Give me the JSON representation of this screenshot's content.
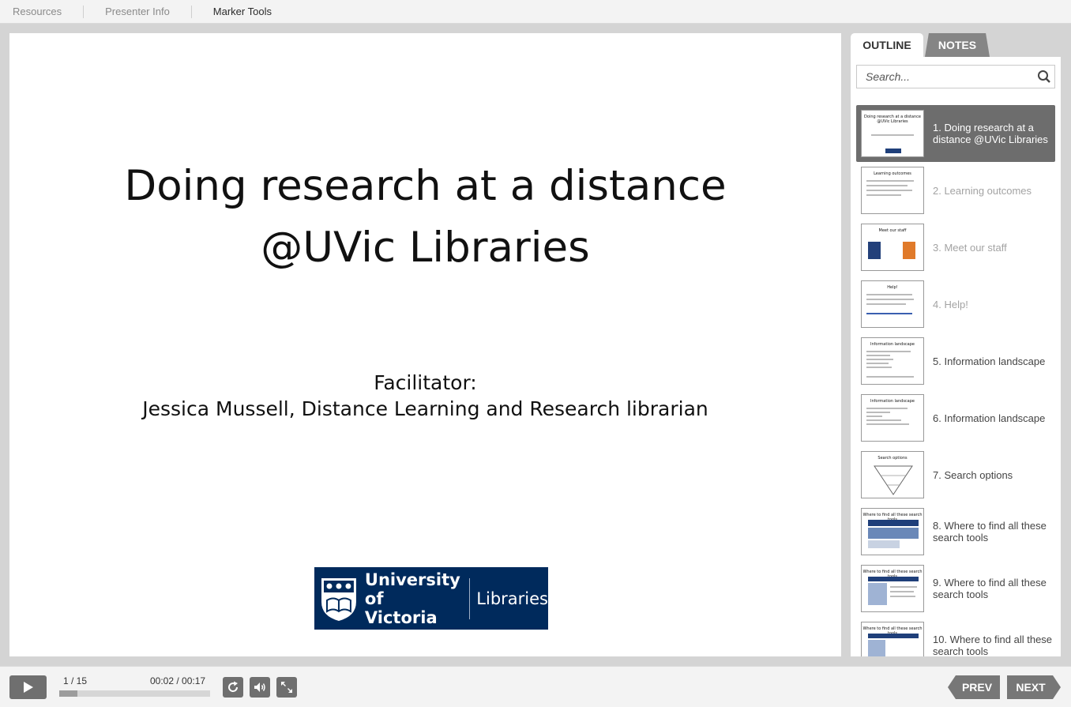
{
  "top_menu": {
    "resources": "Resources",
    "presenter_info": "Presenter Info",
    "marker_tools": "Marker Tools"
  },
  "slide": {
    "title_line1": "Doing research at a distance",
    "title_line2": "@UVic Libraries",
    "sub_line1": "Facilitator:",
    "sub_line2": "Jessica Mussell, Distance Learning and Research librarian",
    "logo_line1": "University",
    "logo_line2": "of Victoria",
    "logo_libraries": "Libraries",
    "logo_color": "#002a5c"
  },
  "sidebar": {
    "tab_outline": "OUTLINE",
    "tab_notes": "NOTES",
    "search_placeholder": "Search...",
    "items": [
      {
        "label": "1. Doing research at a distance @UVic Libraries",
        "thumb_title": "Doing research at a distance @UVic Libraries"
      },
      {
        "label": "2. Learning outcomes",
        "thumb_title": "Learning outcomes"
      },
      {
        "label": "3. Meet our staff",
        "thumb_title": "Meet our staff"
      },
      {
        "label": "4. Help!",
        "thumb_title": "Help!"
      },
      {
        "label": "5. Information landscape",
        "thumb_title": "Information landscape"
      },
      {
        "label": "6. Information landscape",
        "thumb_title": "Information landscape"
      },
      {
        "label": "7. Search options",
        "thumb_title": "Search options"
      },
      {
        "label": "8. Where to find all these search tools",
        "thumb_title": "Where to find all these search tools"
      },
      {
        "label": "9. Where to find all these search tools",
        "thumb_title": "Where to find all these search tools"
      },
      {
        "label": "10. Where to find all these search tools",
        "thumb_title": "Where to find all these search tools"
      }
    ]
  },
  "player": {
    "slide_count": "1 / 15",
    "timecode": "00:02 / 00:17",
    "progress_fraction": 0.118,
    "prev_label": "PREV",
    "next_label": "NEXT",
    "icons": [
      "play-icon",
      "replay-icon",
      "volume-icon",
      "fullscreen-icon",
      "search-icon"
    ]
  }
}
